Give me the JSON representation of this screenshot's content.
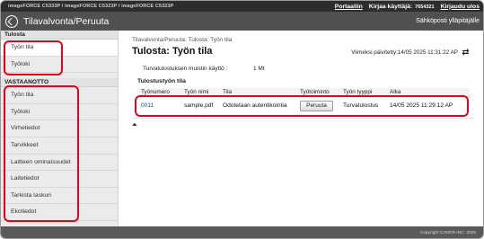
{
  "header": {
    "model_text": "imageFORCE C5333P / imageFORCE C5323P / imageFORCE C5323P",
    "portal_link": "Portaaliin",
    "logged_user_label": "Kirjaa käyttäjä:",
    "logged_user_value": "7654321",
    "logout_link": "Kirjaudu ulos"
  },
  "titlebar": {
    "home_icon": "home-icon",
    "title": "Tilavalvonta/Peruuta",
    "email_link": "Sähköposti ylläpitäjälle"
  },
  "sidebar": {
    "sections": [
      {
        "title": "Tulosta",
        "items": [
          "Työn tila",
          "Työloki"
        ]
      },
      {
        "title": "VASTAANOTTO",
        "items": [
          "Työn tila",
          "Työloki",
          "Virhetiedot",
          "Tarvikkeet",
          "Laitteen ominaisuudet",
          "Laitetiedot",
          "Tarkista laskuri",
          "Ekotiedot"
        ]
      }
    ],
    "active_item": "Työn tila"
  },
  "main": {
    "breadcrumb": "Tilavalvonta/Peruuta: Tulosta: Työn tila",
    "page_title": "Tulosta: Työn tila",
    "last_updated": "Viimeksi päivitetty:14/05 2025 11:31:22 AP",
    "refresh_icon": "refresh-icon",
    "memory_label": "Turvatulostuksen muistin käyttö :",
    "memory_value": "1 Mt",
    "table_title": "Tulostustyön tila",
    "columns": [
      "Työnumero",
      "Työn nimi",
      "Tila",
      "Työtoiminto",
      "Työn tyyppi",
      "Alka"
    ],
    "rows": [
      {
        "number": "0011",
        "name": "sample.pdf",
        "status": "Odotetaan autentikointia",
        "action": "Peruuta",
        "type": "Turvatulostus",
        "start": "14/05 2025 11:29:12 AP"
      }
    ],
    "top_link_icon": "back-to-top-icon",
    "top_link_glyph": "⏶"
  },
  "footer": {
    "copyright": "Copyright CANON INC. 2025"
  },
  "colors": {
    "highlight": "#e8001c",
    "titlebar": "#505050",
    "topbar": "#2d2d2d"
  }
}
